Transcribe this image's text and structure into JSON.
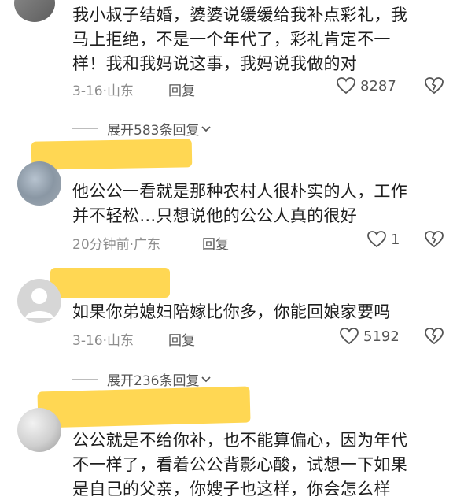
{
  "comments": [
    {
      "lines": [
        "我小叔子结婚，婆婆说缓缓给我补点彩礼，我",
        "马上拒绝，不是一个年代了，彩礼肯定不一",
        "样！我和我妈说这事，我妈说我做的对"
      ],
      "time": "3-16",
      "location": "山东",
      "reply": "回复",
      "likes": "8287",
      "expand": "展开583条回复"
    },
    {
      "lines": [
        "他公公一看就是那种农村人很朴实的人，工作",
        "并不轻松…只想说他的公公人真的很好"
      ],
      "time": "20分钟前",
      "location": "广东",
      "reply": "回复",
      "likes": "1"
    },
    {
      "lines": [
        "如果你弟媳妇陪嫁比你多，你能回娘家要吗"
      ],
      "time": "3-16",
      "location": "山东",
      "reply": "回复",
      "likes": "5192",
      "expand": "展开236条回复"
    },
    {
      "lines": [
        "公公就是不给你补，也不能算偏心，因为年代",
        "不一样了，看着公公背影心酸，试想一下如果",
        "是自己的父亲，你嫂子也这样，你会怎么样"
      ]
    }
  ],
  "colors": {
    "highlight": "#ffd54a",
    "meta": "#8e8e8e"
  }
}
